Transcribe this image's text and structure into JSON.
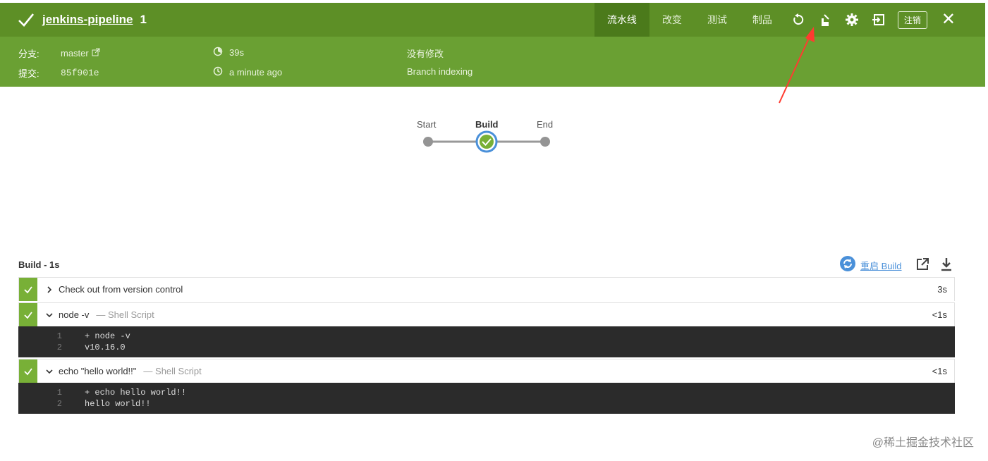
{
  "header": {
    "title": "jenkins-pipeline",
    "run_number": "1",
    "tabs": [
      {
        "label": "流水线",
        "active": true
      },
      {
        "label": "改变",
        "active": false
      },
      {
        "label": "测试",
        "active": false
      },
      {
        "label": "制品",
        "active": false
      }
    ],
    "logout_label": "注销",
    "close_label": "✕",
    "icons": [
      "replay-icon",
      "annotation-cursor-icon",
      "gear-icon",
      "exit-icon"
    ]
  },
  "summary": {
    "branch_label": "分支:",
    "branch_value": "master",
    "commit_label": "提交:",
    "commit_value": "85f901e",
    "duration": "39s",
    "time_ago": "a minute ago",
    "changes": "没有修改",
    "cause": "Branch indexing"
  },
  "pipeline": {
    "stages": [
      "Start",
      "Build",
      "End"
    ],
    "selected": "Build"
  },
  "build": {
    "title": "Build - 1s",
    "restart_label": "重启 Build",
    "steps": [
      {
        "name": "Check out from version control",
        "type": "",
        "time": "3s",
        "expanded": false,
        "log": []
      },
      {
        "name": "node -v",
        "type": "— Shell Script",
        "time": "<1s",
        "expanded": true,
        "log": [
          {
            "n": "1",
            "text": "+ node -v"
          },
          {
            "n": "2",
            "text": "v10.16.0"
          }
        ]
      },
      {
        "name": "echo \"hello world!!\"",
        "type": "— Shell Script",
        "time": "<1s",
        "expanded": true,
        "log": [
          {
            "n": "1",
            "text": "+ echo hello world!!"
          },
          {
            "n": "2",
            "text": "hello world!!"
          }
        ]
      }
    ]
  },
  "watermark": "@稀土掘金技术社区",
  "colors": {
    "header": "#5d8f26",
    "subheader": "#6aa033",
    "success": "#78b037",
    "link": "#4a90d9",
    "annotation_arrow": "#ff3b30"
  }
}
